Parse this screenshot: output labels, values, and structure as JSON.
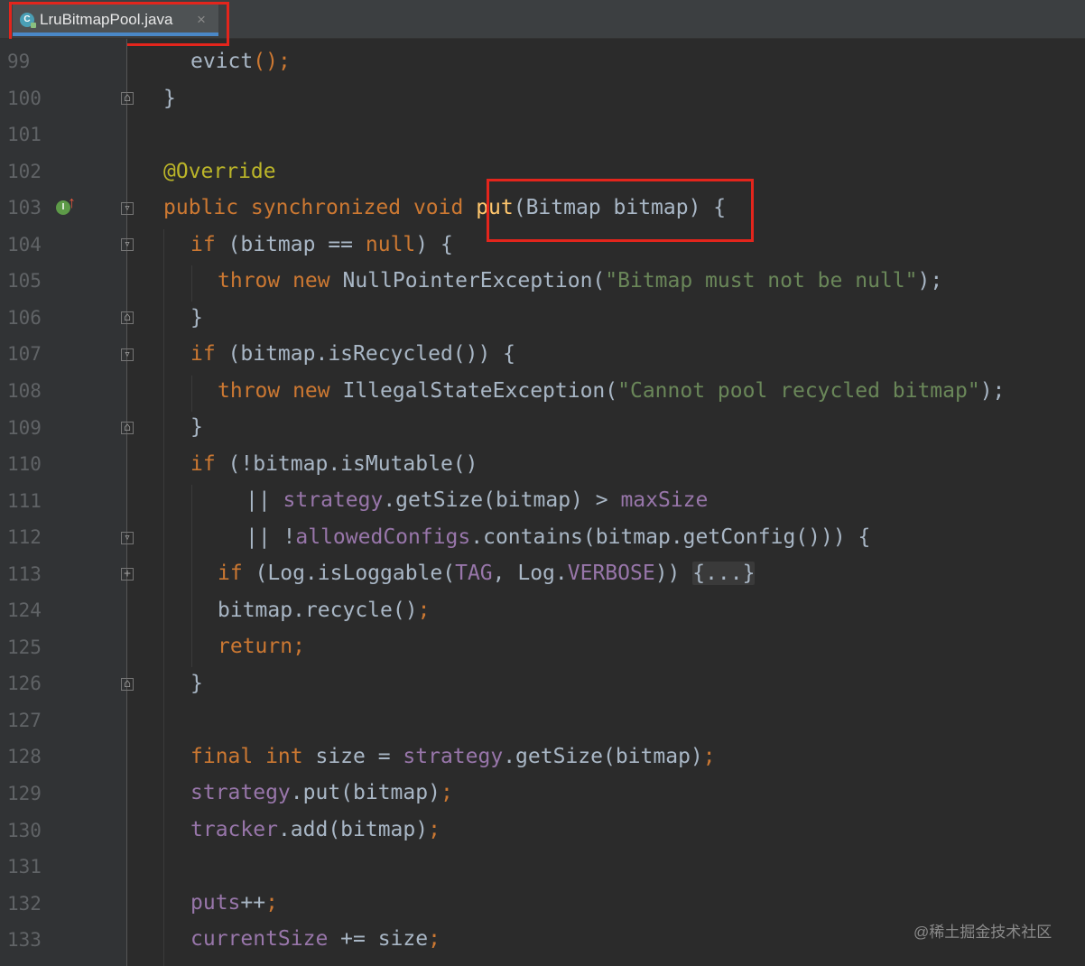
{
  "tab": {
    "file_name": "LruBitmapPool.java",
    "close_glyph": "×",
    "icon": "java-class-icon"
  },
  "gutter": {
    "line_numbers": [
      "99",
      "100",
      "101",
      "102",
      "103",
      "104",
      "105",
      "106",
      "107",
      "108",
      "109",
      "110",
      "111",
      "112",
      "113",
      "124",
      "125",
      "126",
      "127",
      "128",
      "129",
      "130",
      "131",
      "132",
      "133"
    ],
    "override_marker": {
      "glyph": "I",
      "arrow": "↑"
    }
  },
  "code": {
    "l99": "evict",
    "l99b": "();",
    "l100": "}",
    "l102": "@Override",
    "l103a": "public synchronized void ",
    "l103b": "put",
    "l103c": "(Bitmap bitmap) {",
    "l104a": "if ",
    "l104b": "(bitmap == ",
    "l104c": "null",
    "l104d": ") {",
    "l105a": "throw new ",
    "l105b": "NullPointerException(",
    "l105c": "\"Bitmap must not be null\"",
    "l105d": ");",
    "l106": "}",
    "l107a": "if ",
    "l107b": "(bitmap.isRecycled()) {",
    "l108a": "throw new ",
    "l108b": "IllegalStateException(",
    "l108c": "\"Cannot pool recycled bitmap\"",
    "l108d": ");",
    "l109": "}",
    "l110a": "if ",
    "l110b": "(!bitmap.isMutable()",
    "l111a": "|| ",
    "l111b": "strategy",
    "l111c": ".getSize(bitmap) > ",
    "l111d": "maxSize",
    "l112a": "|| !",
    "l112b": "allowedConfigs",
    "l112c": ".contains(bitmap.getConfig())) {",
    "l113a": "if ",
    "l113b": "(Log.isLoggable(",
    "l113c": "TAG",
    "l113d": ", Log.",
    "l113e": "VERBOSE",
    "l113f": ")) ",
    "l113g": "{...}",
    "l124a": "bitmap.recycle()",
    "l124b": ";",
    "l125": "return;",
    "l126": "}",
    "l128a": "final int ",
    "l128b": "size = ",
    "l128c": "strategy",
    "l128d": ".getSize(bitmap)",
    "l128e": ";",
    "l129a": "strategy",
    "l129b": ".put(bitmap)",
    "l129c": ";",
    "l130a": "tracker",
    "l130b": ".add(bitmap)",
    "l130c": ";",
    "l132a": "puts",
    "l132b": "++",
    "l132c": ";",
    "l133a": "currentSize ",
    "l133b": "+= size",
    "l133c": ";"
  },
  "watermark": "@稀土掘金技术社区",
  "colors": {
    "background": "#2b2b2b",
    "keyword": "#cc7832",
    "string": "#6a8759",
    "field": "#9876aa",
    "annotation": "#bbb529",
    "method_decl": "#ffc66d",
    "highlight_box": "#e3251c"
  }
}
